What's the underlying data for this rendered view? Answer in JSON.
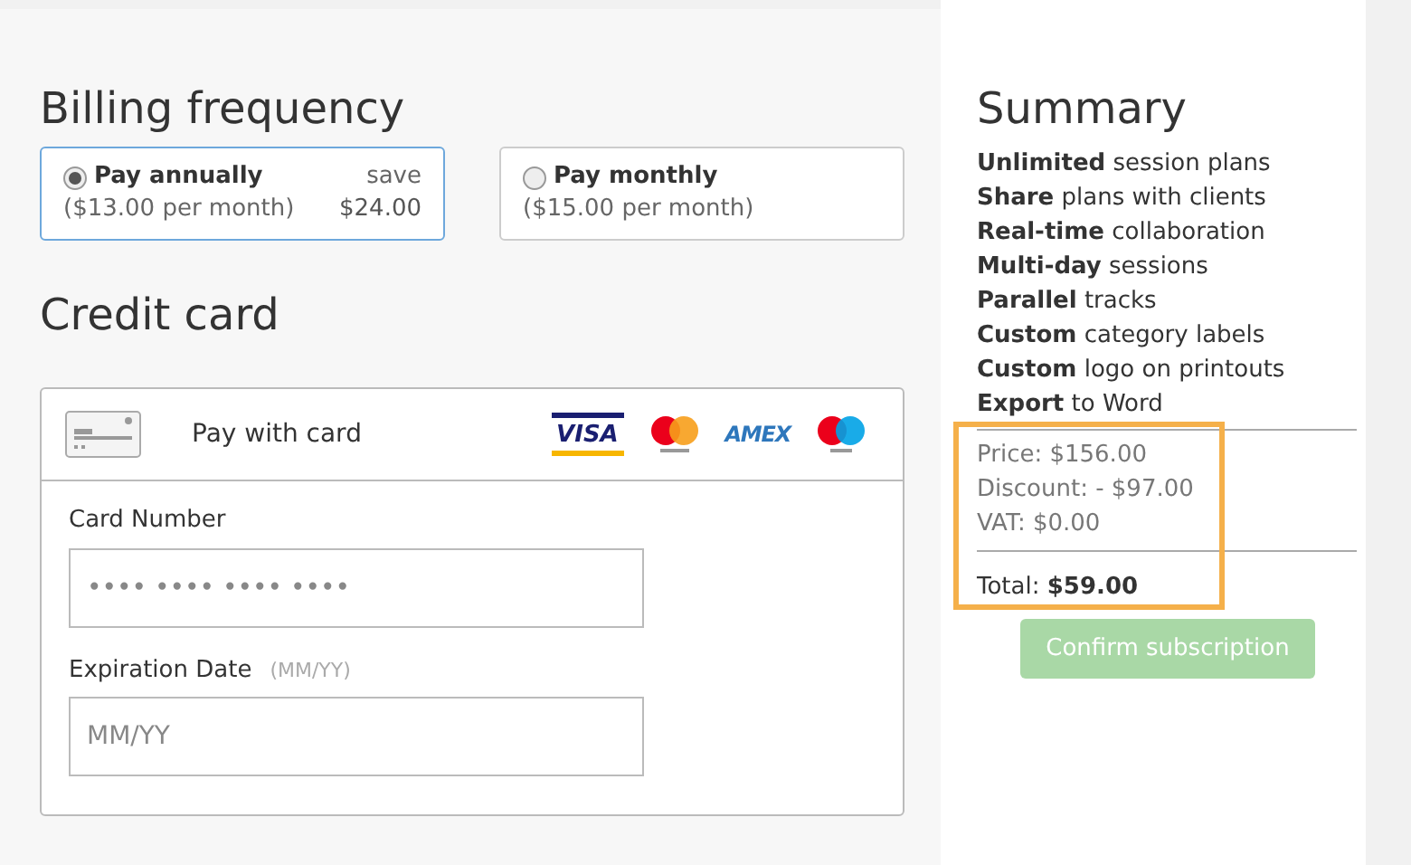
{
  "billing": {
    "title": "Billing frequency",
    "options": [
      {
        "label": "Pay annually",
        "sub": "($13.00 per month)",
        "save_label": "save",
        "save_amount": "$24.00",
        "selected": true
      },
      {
        "label": "Pay monthly",
        "sub": "($15.00 per month)",
        "selected": false
      }
    ]
  },
  "credit_card": {
    "title": "Credit card",
    "pay_label": "Pay with card",
    "brands": [
      {
        "kind": "visa",
        "label": "VISA"
      },
      {
        "kind": "mastercard"
      },
      {
        "kind": "amex",
        "label": "AMEX"
      },
      {
        "kind": "maestro"
      }
    ],
    "fields": [
      {
        "label": "Card Number",
        "placeholder": "•••• •••• •••• ••••"
      },
      {
        "label": "Expiration Date",
        "hint": "(MM/YY)",
        "placeholder": "MM/YY"
      }
    ]
  },
  "summary": {
    "title": "Summary",
    "features": [
      "**Unlimited** session plans",
      "**Share** plans with clients",
      "**Real-time** collaboration",
      "**Multi-day** sessions",
      "**Parallel** tracks",
      "**Custom** category labels",
      "**Custom** logo on printouts",
      "**Export** to Word"
    ],
    "lines": [
      "Price: $156.00",
      "Discount: - $97.00",
      "VAT: $0.00"
    ],
    "total": "Total: **$59.00**",
    "confirm": {
      "label": "Confirm subscription",
      "disabled": true
    }
  }
}
